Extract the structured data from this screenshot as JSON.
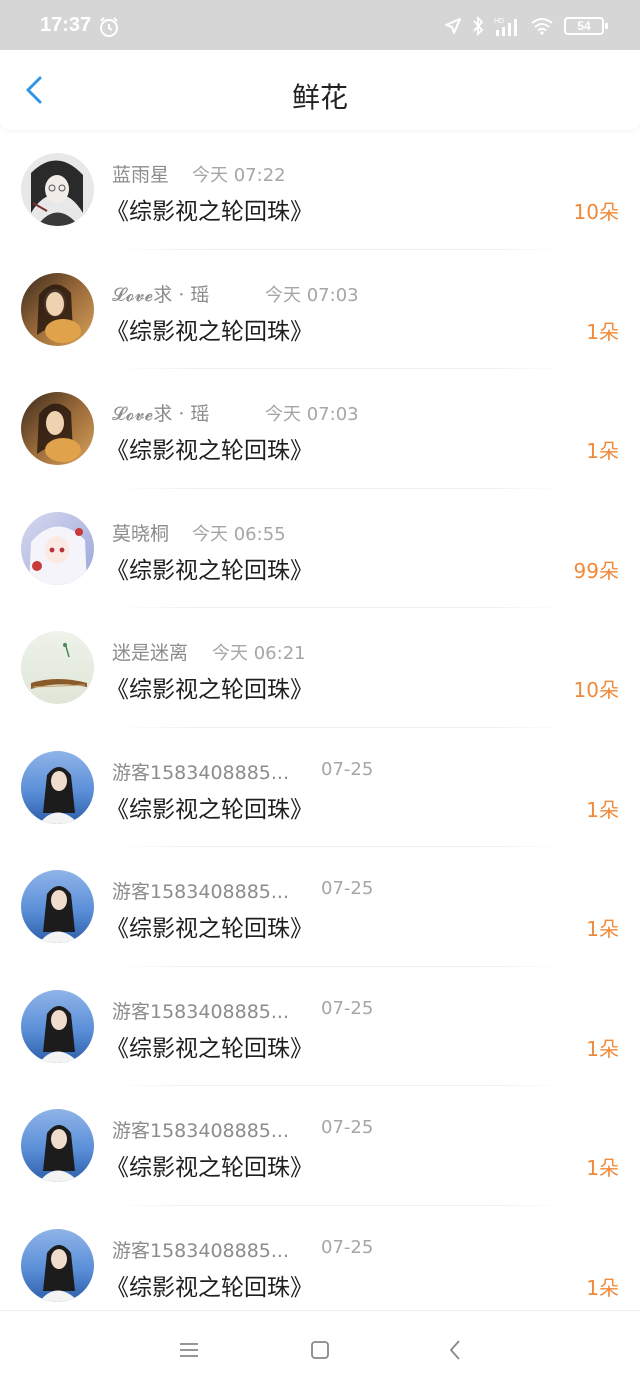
{
  "status_bar": {
    "time": "17:37",
    "battery": "54",
    "icons": [
      "alarm-icon",
      "location-icon",
      "bluetooth-icon",
      "hd-signal-icon",
      "wifi-icon",
      "battery-icon"
    ]
  },
  "header": {
    "title": "鲜花",
    "back_icon": "chevron-left-icon",
    "accent_color": "#2f95e6"
  },
  "gifts": [
    {
      "user": "蓝雨星",
      "time": "今天 07:22",
      "book": "《综影视之轮回珠》",
      "count": "10朵"
    },
    {
      "user": "𝓛𝓸𝓿𝓮求 · 瑶",
      "time": "今天 07:03",
      "book": "《综影视之轮回珠》",
      "count": "1朵"
    },
    {
      "user": "𝓛𝓸𝓿𝓮求 · 瑶",
      "time": "今天 07:03",
      "book": "《综影视之轮回珠》",
      "count": "1朵"
    },
    {
      "user": "莫晓桐",
      "time": "今天 06:55",
      "book": "《综影视之轮回珠》",
      "count": "99朵"
    },
    {
      "user": "迷是迷离",
      "time": "今天 06:21",
      "book": "《综影视之轮回珠》",
      "count": "10朵"
    },
    {
      "user": "游客1583408885...",
      "time": "07-25",
      "book": "《综影视之轮回珠》",
      "count": "1朵"
    },
    {
      "user": "游客1583408885...",
      "time": "07-25",
      "book": "《综影视之轮回珠》",
      "count": "1朵"
    },
    {
      "user": "游客1583408885...",
      "time": "07-25",
      "book": "《综影视之轮回珠》",
      "count": "1朵"
    },
    {
      "user": "游客1583408885...",
      "time": "07-25",
      "book": "《综影视之轮回珠》",
      "count": "1朵"
    },
    {
      "user": "游客1583408885...",
      "time": "07-25",
      "book": "《综影视之轮回珠》",
      "count": "1朵"
    }
  ],
  "colors": {
    "count": "#f08a3a",
    "status_bar_bg": "#d6d6d6"
  },
  "nav_bar": {
    "icons": [
      "menu-icon",
      "home-square-icon",
      "back-triangle-icon"
    ]
  }
}
